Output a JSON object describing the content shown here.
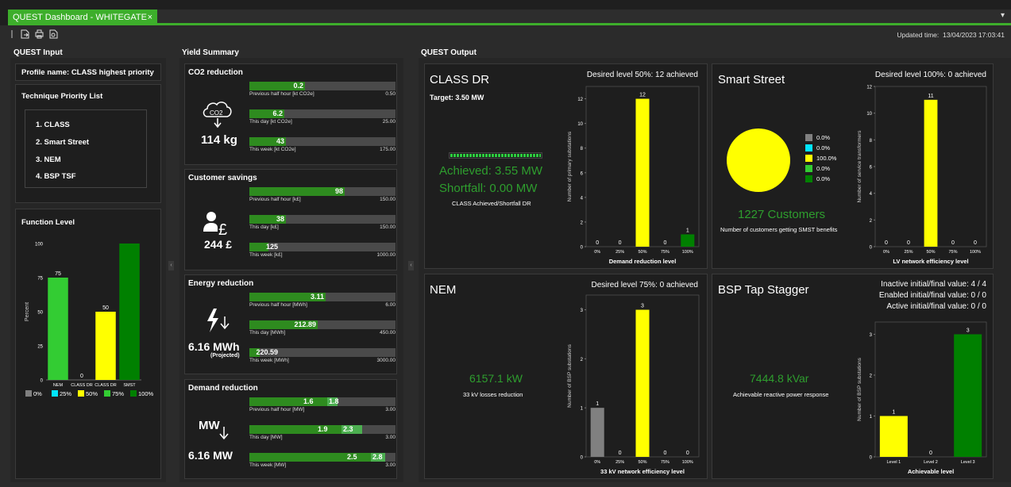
{
  "tab": {
    "title": "QUEST Dashboard - WHITEGATE GSP",
    "close": "×"
  },
  "toolbar": {
    "updated_label": "Updated time:",
    "updated_value": "13/04/2023 17:03:41",
    "menu": "▾"
  },
  "sections": {
    "input": "QUEST Input",
    "yield": "Yield Summary",
    "output": "QUEST Output"
  },
  "input": {
    "profile": "Profile name: CLASS highest priority",
    "technique_title": "Technique Priority List",
    "techniques": [
      "1. CLASS",
      "2. Smart Street",
      "3. NEM",
      "4. BSP TSF"
    ],
    "function_level_title": "Function Level"
  },
  "function_level": {
    "type": "bar",
    "ylabel": "Percent",
    "ylim": [
      0,
      100
    ],
    "yticks": [
      "0",
      "25",
      "50",
      "75",
      "100"
    ],
    "categories": [
      "NEM",
      "CLASS DR",
      "CLASS DR",
      "SMST"
    ],
    "values": [
      75,
      0,
      50,
      100
    ],
    "labels": [
      "75",
      "0",
      "50",
      ""
    ],
    "colors": [
      "#33cc33",
      "#33cc33",
      "#ffff00",
      "#008000"
    ],
    "legend": [
      {
        "label": "0%",
        "color": "#808080"
      },
      {
        "label": "25%",
        "color": "#00e5ff"
      },
      {
        "label": "50%",
        "color": "#ffff00"
      },
      {
        "label": "75%",
        "color": "#33cc33"
      },
      {
        "label": "100%",
        "color": "#008000"
      }
    ]
  },
  "yield": {
    "co2": {
      "title": "CO2 reduction",
      "total": "114 kg",
      "icon": "co2-cloud-icon",
      "rows": [
        {
          "value": "0.2",
          "label": "Previous half hour [kt CO2e]",
          "max": "0.50",
          "frac": 0.38
        },
        {
          "value": "6.2",
          "label": "This day [kt CO2e]",
          "max": "25.00",
          "frac": 0.24
        },
        {
          "value": "43",
          "label": "This week [kt CO2e]",
          "max": "175.00",
          "frac": 0.25
        }
      ]
    },
    "savings": {
      "title": "Customer savings",
      "total": "244 £",
      "icon": "person-pound-icon",
      "rows": [
        {
          "value": "98",
          "label": "Previous half hour [k£]",
          "max": "150.00",
          "frac": 0.65
        },
        {
          "value": "38",
          "label": "This day [k£]",
          "max": "150.00",
          "frac": 0.25
        },
        {
          "value": "125",
          "label": "This week [k£]",
          "max": "1000.00",
          "frac": 0.13
        }
      ]
    },
    "energy": {
      "title": "Energy reduction",
      "total": "6.16 MWh",
      "note": "(Projected)",
      "icon": "lightning-icon",
      "rows": [
        {
          "value": "3.11",
          "label": "Previous half hour [MWh]",
          "max": "6.00",
          "frac": 0.52
        },
        {
          "value": "212.89",
          "label": "This day [MWh]",
          "max": "450.00",
          "frac": 0.47
        },
        {
          "value": "220.59",
          "label": "This week [MWh]",
          "max": "3000.00",
          "frac": 0.07
        }
      ]
    },
    "demand": {
      "title": "Demand reduction",
      "total": "6.16 MW",
      "icon_text": "MW",
      "icon": "mw-arrow-icon",
      "rows": [
        {
          "value": "1.6",
          "value2": "1.8",
          "label": "Previous half hour [MW]",
          "max": "3.00",
          "frac": 0.53,
          "frac2": 0.07
        },
        {
          "value": "1.9",
          "value2": "2.3",
          "label": "This day [MW]",
          "max": "3.00",
          "frac": 0.63,
          "frac2": 0.14
        },
        {
          "value": "2.5",
          "value2": "2.8",
          "label": "This week [MW]",
          "max": "3.00",
          "frac": 0.83,
          "frac2": 0.1
        }
      ]
    }
  },
  "output": {
    "class": {
      "title": "CLASS DR",
      "desired": "Desired level 50%: 12 achieved",
      "target": "Target: 3.50 MW",
      "achieved": "Achieved: 3.55 MW",
      "shortfall": "Shortfall: 0.00 MW",
      "caption": "CLASS Achieved/Shortfall DR",
      "progress": 1.0
    },
    "smart": {
      "title": "Smart Street",
      "desired": "Desired level 100%: 0 achieved",
      "customers": "1227 Customers",
      "caption": "Number of customers getting SMST benefits",
      "pie_legend": [
        {
          "label": "0.0%",
          "color": "#808080"
        },
        {
          "label": "0.0%",
          "color": "#00e5ff"
        },
        {
          "label": "100.0%",
          "color": "#ffff00"
        },
        {
          "label": "0.0%",
          "color": "#33cc33"
        },
        {
          "label": "0.0%",
          "color": "#008000"
        }
      ],
      "pie_values": [
        0,
        0,
        100,
        0,
        0
      ]
    },
    "nem": {
      "title": "NEM",
      "desired": "Desired level 75%: 0 achieved",
      "value": "6157.1 kW",
      "caption": "33 kV losses reduction"
    },
    "bsp": {
      "title": "BSP Tap Stagger",
      "lines": [
        "Inactive initial/final value: 4 / 4",
        "Enabled initial/final value: 0 / 0",
        "Active initial/final value: 0 / 0"
      ],
      "value": "7444.8 kVar",
      "caption": "Achievable reactive power response"
    }
  },
  "chart_data": [
    {
      "type": "bar",
      "id": "class",
      "title": "",
      "xlabel": "Demand reduction level",
      "ylabel": "Number of primary substations",
      "categories": [
        "0%",
        "25%",
        "50%",
        "75%",
        "100%"
      ],
      "values": [
        0,
        0,
        12,
        0,
        1
      ],
      "colors": [
        "#808080",
        "#00e5ff",
        "#ffff00",
        "#33cc33",
        "#008000"
      ],
      "ylim": [
        0,
        13
      ],
      "yticks": [
        0,
        2,
        4,
        6,
        8,
        10,
        12
      ]
    },
    {
      "type": "bar",
      "id": "smart",
      "title": "",
      "xlabel": "LV network efficiency level",
      "ylabel": "Number of service transformers",
      "categories": [
        "0%",
        "25%",
        "50%",
        "75%",
        "100%"
      ],
      "values": [
        0,
        0,
        11,
        0,
        0
      ],
      "colors": [
        "#808080",
        "#00e5ff",
        "#ffff00",
        "#33cc33",
        "#008000"
      ],
      "ylim": [
        0,
        12
      ],
      "yticks": [
        0,
        2,
        4,
        6,
        8,
        10,
        12
      ]
    },
    {
      "type": "bar",
      "id": "nem",
      "title": "",
      "xlabel": "33 kV network efficiency level",
      "ylabel": "Number of BSP substations",
      "categories": [
        "0%",
        "25%",
        "50%",
        "75%",
        "100%"
      ],
      "values": [
        1,
        0,
        3,
        0,
        0
      ],
      "colors": [
        "#808080",
        "#00e5ff",
        "#ffff00",
        "#33cc33",
        "#008000"
      ],
      "ylim": [
        0,
        3.3
      ],
      "yticks": [
        0,
        1,
        2,
        3
      ]
    },
    {
      "type": "bar",
      "id": "bsp",
      "title": "",
      "xlabel": "Achievable level",
      "ylabel": "Number of BSP substations",
      "categories": [
        "Level 1",
        "Level 2",
        "Level 3"
      ],
      "values": [
        1,
        0,
        3
      ],
      "colors": [
        "#ffff00",
        "#33cc33",
        "#008000"
      ],
      "ylim": [
        0,
        3.3
      ],
      "yticks": [
        0,
        1,
        2,
        3
      ]
    }
  ]
}
